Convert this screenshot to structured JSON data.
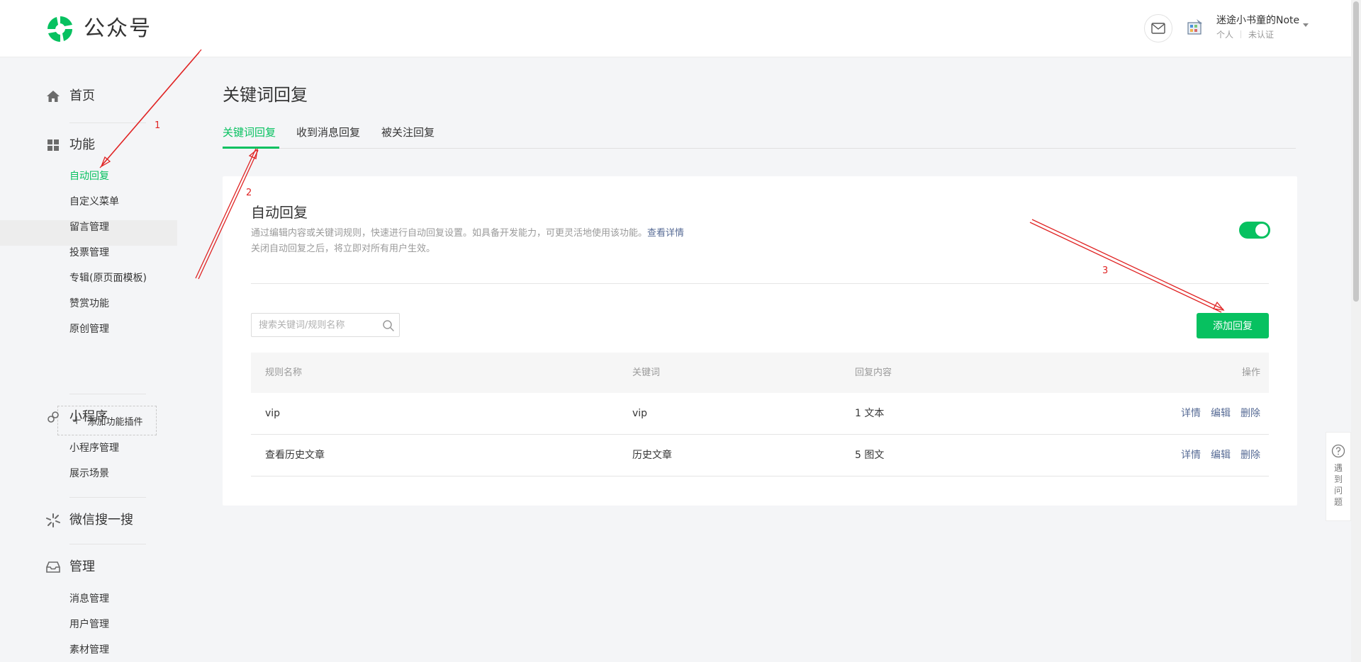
{
  "header": {
    "brand": "公众号",
    "user_name": "迷途小书童的Note",
    "account_type": "个人",
    "verify_status": "未认证"
  },
  "sidebar": {
    "groups": [
      {
        "label": "首页",
        "icon": "home-icon"
      },
      {
        "label": "功能",
        "icon": "grid-icon",
        "items": [
          "自动回复",
          "自定义菜单",
          "留言管理",
          "投票管理",
          "专辑(原页面模板)",
          "赞赏功能",
          "原创管理"
        ]
      },
      {
        "label": "小程序",
        "icon": "link-icon",
        "items": [
          "小程序管理",
          "展示场景"
        ]
      },
      {
        "label": "微信搜一搜",
        "icon": "sparkle-icon"
      },
      {
        "label": "管理",
        "icon": "inbox-icon",
        "items": [
          "消息管理",
          "用户管理",
          "素材管理"
        ]
      }
    ],
    "active_item": "自动回复",
    "add_plugin_label": "添加功能插件"
  },
  "main": {
    "title": "关键词回复",
    "tabs": [
      "关键词回复",
      "收到消息回复",
      "被关注回复"
    ],
    "active_tab": 0,
    "card": {
      "title": "自动回复",
      "desc1": "通过编辑内容或关键词规则，快速进行自动回复设置。如具备开发能力，可更灵活地使用该功能。",
      "desc1_link": "查看详情",
      "desc2": "关闭自动回复之后，将立即对所有用户生效。",
      "toggle_on": true,
      "search_placeholder": "搜索关键词/规则名称",
      "add_button": "添加回复",
      "table": {
        "headers": [
          "规则名称",
          "关键词",
          "回复内容",
          "操作"
        ],
        "rows": [
          {
            "name": "vip",
            "keyword": "vip",
            "content": "1 文本",
            "actions": [
              "详情",
              "编辑",
              "删除"
            ]
          },
          {
            "name": "查看历史文章",
            "keyword": "历史文章",
            "content": "5 图文",
            "actions": [
              "详情",
              "编辑",
              "删除"
            ]
          }
        ]
      }
    }
  },
  "help": {
    "label": "遇到问题"
  },
  "annotations": {
    "labels": [
      "1",
      "2",
      "3"
    ]
  },
  "colors": {
    "accent": "#07c160",
    "link": "#576b95",
    "annotation": "#e02424"
  }
}
